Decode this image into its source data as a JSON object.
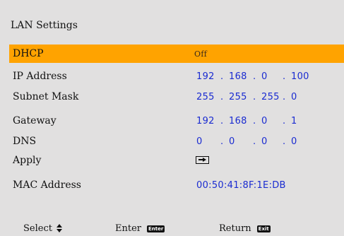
{
  "menu": {
    "title": "LAN Settings",
    "rows": [
      {
        "label": "DHCP",
        "value": "Off",
        "selected": true
      },
      {
        "label": "IP Address",
        "octets": [
          "192",
          "168",
          "0",
          "100"
        ]
      },
      {
        "label": "Subnet Mask",
        "octets": [
          "255",
          "255",
          "255",
          "0"
        ]
      },
      {
        "label": "Gateway",
        "octets": [
          "192",
          "168",
          "0",
          "1"
        ]
      },
      {
        "label": "DNS",
        "octets": [
          "0",
          "0",
          "0",
          "0"
        ]
      },
      {
        "label": "Apply",
        "icon": "enter-arrow-icon"
      },
      {
        "label": "MAC Address",
        "value": "00:50:41:8F:1E:DB"
      }
    ]
  },
  "footer": {
    "select_label": "Select",
    "enter_label": "Enter",
    "enter_key": "Enter",
    "return_label": "Return",
    "return_key": "Exit"
  },
  "colors": {
    "panel_bg": "#e1e0e0",
    "selected_bg": "#ffa300",
    "value_text": "#1a2bd1"
  }
}
